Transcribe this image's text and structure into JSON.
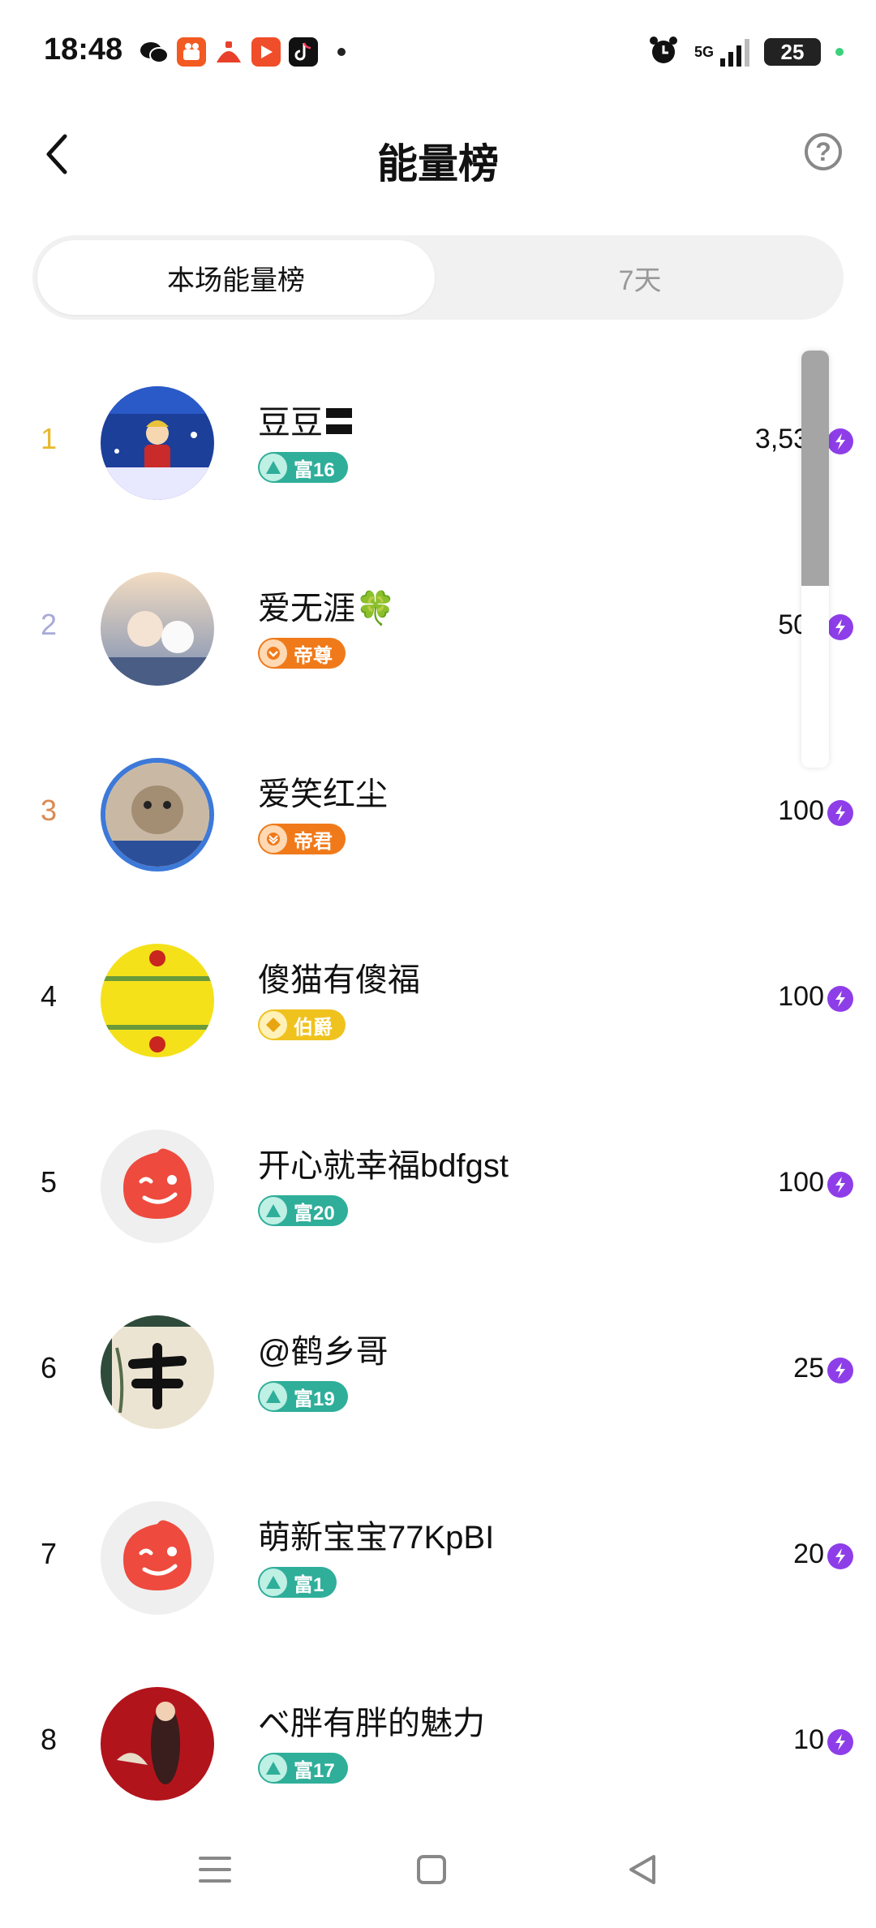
{
  "status_bar": {
    "time": "18:48",
    "network": "5G",
    "battery": "25",
    "app_icons": [
      "wechat-icon",
      "kuaishou-icon",
      "red-app-icon",
      "video-app-icon",
      "tiktok-icon"
    ]
  },
  "header": {
    "title": "能量榜",
    "back_icon": "chevron-left-icon",
    "help_icon": "question-circle-icon",
    "help_glyph": "?"
  },
  "tabs": [
    {
      "label": "本场能量榜",
      "active": true
    },
    {
      "label": "7天",
      "active": false
    }
  ],
  "ranking": [
    {
      "rank": "1",
      "name": "豆豆〓",
      "badge": "富16",
      "badge_type": "wealth",
      "score": "3,530",
      "rank_color": "#e8b92c"
    },
    {
      "rank": "2",
      "name": "爱无涯🍀",
      "badge": "帝尊",
      "badge_type": "emperor",
      "score": "500",
      "rank_color": "#a9a9d9"
    },
    {
      "rank": "3",
      "name": "爱笑红尘",
      "badge": "帝君",
      "badge_type": "emperor",
      "score": "100",
      "rank_color": "#d98a55"
    },
    {
      "rank": "4",
      "name": "傻猫有傻福",
      "badge": "伯爵",
      "badge_type": "noble",
      "score": "100",
      "rank_color": "#111111"
    },
    {
      "rank": "5",
      "name": "开心就幸福bdfgst",
      "badge": "富20",
      "badge_type": "wealth",
      "score": "100",
      "rank_color": "#111111"
    },
    {
      "rank": "6",
      "name": "@鹤乡哥",
      "badge": "富19",
      "badge_type": "wealth",
      "score": "25",
      "rank_color": "#111111"
    },
    {
      "rank": "7",
      "name": "萌新宝宝77KpBI",
      "badge": "富1",
      "badge_type": "wealth",
      "score": "20",
      "rank_color": "#111111"
    },
    {
      "rank": "8",
      "name": "ベ胖有胖的魅力",
      "badge": "富17",
      "badge_type": "wealth",
      "score": "10",
      "rank_color": "#111111"
    }
  ],
  "colors": {
    "wealth_badge": "#2fae9a",
    "emperor_badge": "#f07a1a",
    "noble_badge": "#f0c21e",
    "energy_icon": "#8e3ee8"
  },
  "score_icon": "energy-bolt-icon",
  "nav_bar": [
    "menu-icon",
    "home-square-icon",
    "back-triangle-icon"
  ]
}
